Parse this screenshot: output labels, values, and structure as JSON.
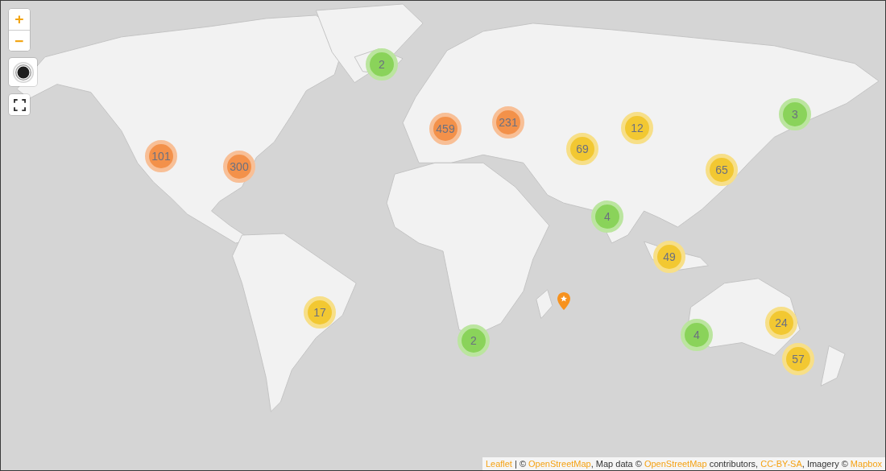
{
  "zoom_controls": {
    "zoom_in": "+",
    "zoom_out": "−"
  },
  "clusters": [
    {
      "count": "2",
      "color": "#8ad35a"
    },
    {
      "count": "459",
      "color": "#f3914a"
    },
    {
      "count": "231",
      "color": "#f3914a"
    },
    {
      "count": "12",
      "color": "#f2c832"
    },
    {
      "count": "3",
      "color": "#8ad35a"
    },
    {
      "count": "101",
      "color": "#f3914a"
    },
    {
      "count": "300",
      "color": "#f3914a"
    },
    {
      "count": "69",
      "color": "#f2c832"
    },
    {
      "count": "65",
      "color": "#f2c832"
    },
    {
      "count": "4",
      "color": "#8ad35a"
    },
    {
      "count": "49",
      "color": "#f2c832"
    },
    {
      "count": "17",
      "color": "#f2c832"
    },
    {
      "count": "2",
      "color": "#8ad35a"
    },
    {
      "count": "4",
      "color": "#8ad35a"
    },
    {
      "count": "24",
      "color": "#f2c832"
    },
    {
      "count": "57",
      "color": "#f2c832"
    }
  ],
  "attribution": [
    {
      "kind": "link",
      "text": "Leaflet"
    },
    {
      "kind": "text",
      "text": " | © "
    },
    {
      "kind": "link",
      "text": "OpenStreetMap"
    },
    {
      "kind": "text",
      "text": ", Map data © "
    },
    {
      "kind": "link",
      "text": "OpenStreetMap"
    },
    {
      "kind": "text",
      "text": " contributors, "
    },
    {
      "kind": "link",
      "text": "CC-BY-SA"
    },
    {
      "kind": "text",
      "text": ", Imagery © "
    },
    {
      "kind": "link",
      "text": "Mapbox"
    }
  ]
}
